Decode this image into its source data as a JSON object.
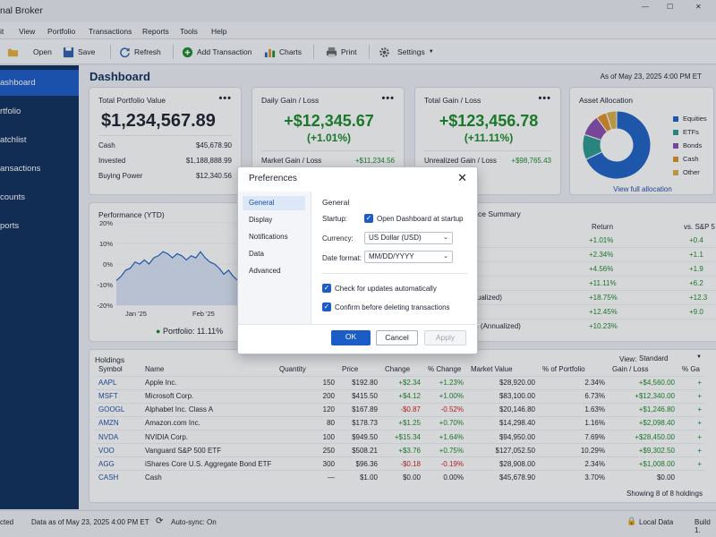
{
  "window": {
    "title": "nal Broker",
    "controls": [
      "—",
      "☐",
      "✕"
    ]
  },
  "menu": [
    "it",
    "View",
    "Portfolio",
    "Transactions",
    "Reports",
    "Tools",
    "Help"
  ],
  "toolbar": {
    "open": "Open",
    "save": "Save",
    "refresh": "Refresh",
    "add": "Add Transaction",
    "charts": "Charts",
    "print": "Print",
    "settings": "Settings"
  },
  "sidebar": [
    "ashboard",
    "rtfolio",
    "atchlist",
    "ansactions",
    "counts",
    "ports"
  ],
  "header": {
    "title": "Dashboard",
    "asof": "As of May 23, 2025 4:00 PM ET"
  },
  "cards": {
    "value": {
      "title": "Total Portfolio Value",
      "amount": "$1,234,567.89",
      "rows": [
        [
          "Cash",
          "$45,678.90"
        ],
        [
          "Invested",
          "$1,188,888.99"
        ],
        [
          "Buying Power",
          "$12,340.56"
        ]
      ]
    },
    "daily": {
      "title": "Daily Gain / Loss",
      "amount": "+$12,345.67",
      "pct": "(+1.01%)",
      "row": [
        "Market Gain / Loss",
        "+$11,234.56"
      ]
    },
    "total": {
      "title": "Total Gain / Loss",
      "amount": "+$123,456.78",
      "pct": "(+11.11%)",
      "row": [
        "Unrealized Gain / Loss",
        "+$98,765.43"
      ]
    },
    "alloc": {
      "title": "Asset Allocation",
      "link": "View full allocation"
    },
    "perf": {
      "title": "Performance (YTD)",
      "legend": "Portfolio: 11.11%"
    },
    "summary": {
      "title": "ce Summary",
      "col1": "Return",
      "col2": "vs. S&P 5",
      "rows": [
        [
          "",
          "+1.01%",
          "+0.4"
        ],
        [
          "",
          "+2.34%",
          "+1.1"
        ],
        [
          "",
          "+4.56%",
          "+1.9"
        ],
        [
          "",
          "+11.11%",
          "+6.2"
        ],
        [
          "nnualized)",
          "+18.75%",
          "+12.3"
        ],
        [
          "",
          "+12.45%",
          "+9.0"
        ],
        [
          "ion (Annualized)",
          "+10.23%",
          ""
        ]
      ]
    }
  },
  "more": "•••",
  "chart_data": [
    {
      "type": "pie",
      "title": "Asset Allocation",
      "categories": [
        "Equities",
        "ETFs",
        "Bonds",
        "Cash",
        "Other"
      ],
      "values": [
        68,
        12,
        10,
        5,
        5
      ],
      "colors": [
        "#1f63c6",
        "#2b9a8f",
        "#8a4fb0",
        "#e0922b",
        "#d8b048"
      ],
      "legend": "right"
    },
    {
      "type": "line",
      "title": "Performance (YTD)",
      "yticks": [
        "20%",
        "10%",
        "0%",
        "-10%",
        "-20%"
      ],
      "xticks": [
        "Jan '25",
        "Feb '25"
      ],
      "ylim": [
        -20,
        20
      ],
      "series": [
        {
          "name": "Portfolio",
          "values": [
            -8,
            -6,
            -3,
            -2,
            1,
            0,
            2,
            0,
            3,
            4,
            6,
            5,
            3,
            5,
            4,
            2,
            4,
            3,
            6,
            3,
            1,
            0,
            -2,
            -5,
            -3,
            -6,
            -8,
            -10
          ]
        }
      ]
    }
  ],
  "holdings": {
    "title": "Holdings",
    "view_label": "View:",
    "view": "Standard",
    "cols": [
      "Symbol",
      "Name",
      "Quantity",
      "Price",
      "Change",
      "% Change",
      "Market Value",
      "% of Portfolio",
      "Gain / Loss",
      "% Ga"
    ],
    "rows": [
      [
        "AAPL",
        "Apple Inc.",
        "150",
        "$192.80",
        "+$2.34",
        "+1.23%",
        "$28,920.00",
        "2.34%",
        "+$4,560.00",
        "+"
      ],
      [
        "MSFT",
        "Microsoft Corp.",
        "200",
        "$415.50",
        "+$4.12",
        "+1.00%",
        "$83,100.00",
        "6.73%",
        "+$12,340.00",
        "+"
      ],
      [
        "GOOGL",
        "Alphabet Inc. Class A",
        "120",
        "$167.89",
        "-$0.87",
        "-0.52%",
        "$20,146.80",
        "1.63%",
        "+$1,246.80",
        "+"
      ],
      [
        "AMZN",
        "Amazon.com Inc.",
        "80",
        "$178.73",
        "+$1.25",
        "+0.70%",
        "$14,298.40",
        "1.16%",
        "+$2,098.40",
        "+"
      ],
      [
        "NVDA",
        "NVIDIA Corp.",
        "100",
        "$949.50",
        "+$15.34",
        "+1.64%",
        "$94,950.00",
        "7.69%",
        "+$28,450.00",
        "+"
      ],
      [
        "VOO",
        "Vanguard S&P 500 ETF",
        "250",
        "$508.21",
        "+$3.76",
        "+0.75%",
        "$127,052.50",
        "10.29%",
        "+$9,302.50",
        "+"
      ],
      [
        "AGG",
        "iShares Core U.S. Aggregate Bond ETF",
        "300",
        "$96.36",
        "-$0.18",
        "-0.19%",
        "$28,908.00",
        "2.34%",
        "+$1,008.00",
        "+"
      ],
      [
        "CASH",
        "Cash",
        "—",
        "$1.00",
        "$0.00",
        "0.00%",
        "$45,678.90",
        "3.70%",
        "$0.00",
        ""
      ]
    ],
    "footer": "Showing 8 of 8 holdings"
  },
  "status": {
    "conn": "cted",
    "data": "Data as of May 23, 2025 4:00 PM ET",
    "sync": "Auto-sync: On",
    "local": "Local Data",
    "build": "Build 1."
  },
  "dialog": {
    "title": "Preferences",
    "nav": [
      "General",
      "Display",
      "Notifications",
      "Data",
      "Advanced"
    ],
    "section": "General",
    "startup_label": "Startup:",
    "startup": "Open Dashboard at startup",
    "currency_label": "Currency:",
    "currency": "US Dollar (USD)",
    "date_label": "Date format:",
    "date": "MM/DD/YYYY",
    "check1": "Check for updates automatically",
    "check2": "Confirm before deleting transactions",
    "ok": "OK",
    "cancel": "Cancel",
    "apply": "Apply"
  }
}
